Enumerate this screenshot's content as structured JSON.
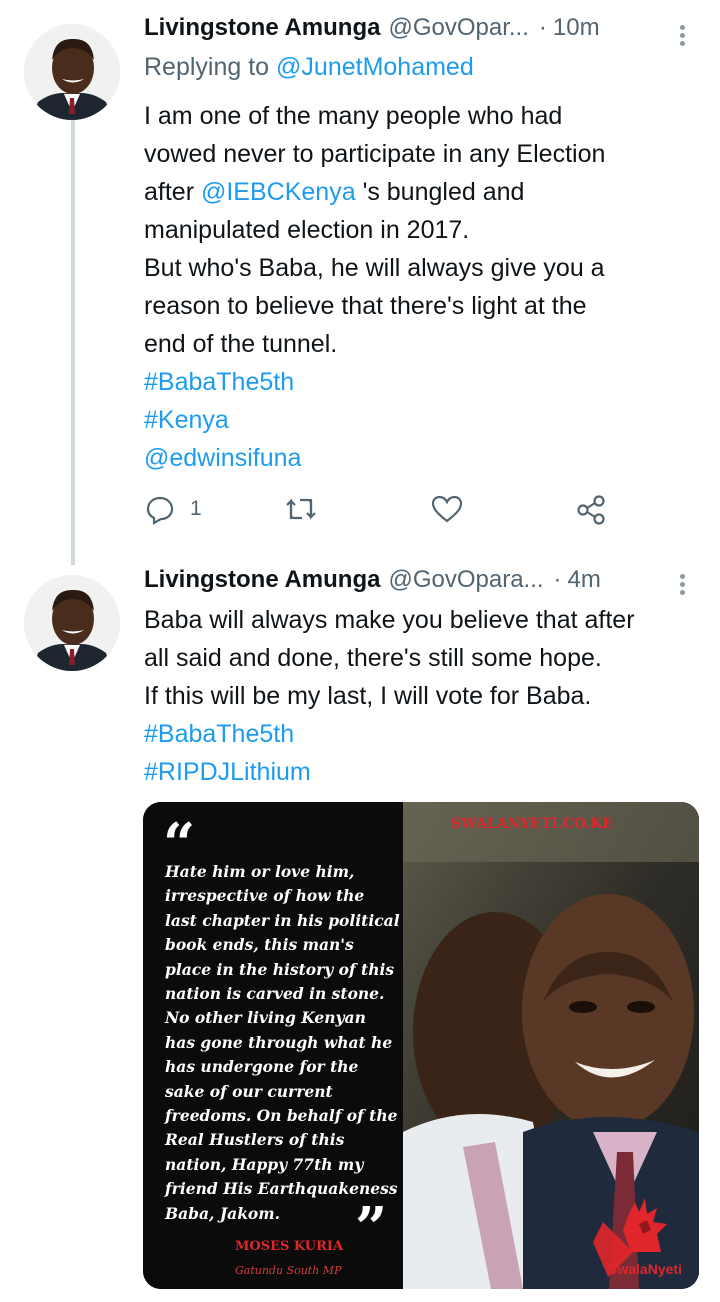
{
  "tweet1": {
    "author_name": "Livingstone Amunga",
    "handle": "@GovOpar...",
    "separator": "·",
    "time": "10m",
    "replying_prefix": "Replying to",
    "replying_to": "@JunetMohamed",
    "body": {
      "line1": "I am one of the many people who had",
      "line2": "vowed never to participate in any Election",
      "line3_pre": "after",
      "line3_mention": "@IEBCKenya",
      "line3_post": "'s bungled and",
      "line4": "manipulated election in 2017.",
      "line5": "But who's Baba, he will always give you a",
      "line6": "reason to believe that there's light at the",
      "line7": "end of the tunnel.",
      "hashtag1": "#BabaThe5th",
      "hashtag2": "#Kenya",
      "mention": "@edwinsifuna"
    },
    "actions": {
      "reply_count": "1"
    }
  },
  "tweet2": {
    "author_name": "Livingstone Amunga",
    "handle": "@GovOpara...",
    "separator": "·",
    "time": "4m",
    "body": {
      "line1": "Baba will always make you believe that after",
      "line2": "all said and done, there's still some hope.",
      "line3": "If this will be my last, I will vote for Baba.",
      "hashtag1": "#BabaThe5th",
      "hashtag2": "#RIPDJLithium"
    },
    "media": {
      "quote_lines": [
        "Hate him or love him,",
        "irrespective of how the",
        "last chapter in his political",
        "book ends, this man's",
        "place in the history of this",
        "nation is carved in stone.",
        "No other living Kenyan",
        "has gone through what he",
        "has undergone for the",
        "sake of our current",
        "freedoms. On behalf of the",
        "Real Hustlers of this",
        "nation, Happy 77th my",
        "friend His Earthquakeness",
        "Baba, Jakom."
      ],
      "quote_author": "MOSES KURIA",
      "quote_author_title": "Gatundu South MP",
      "watermark": "SWALANYETI.CO.KE",
      "brand": "SwalaNyeti"
    }
  },
  "colors": {
    "link": "#1d9bf0",
    "secondary": "#536471",
    "thread": "#cfd9de",
    "brand_red": "#e0262b"
  },
  "icons": [
    "reply-icon",
    "retweet-icon",
    "like-icon",
    "share-icon",
    "more-icon"
  ]
}
